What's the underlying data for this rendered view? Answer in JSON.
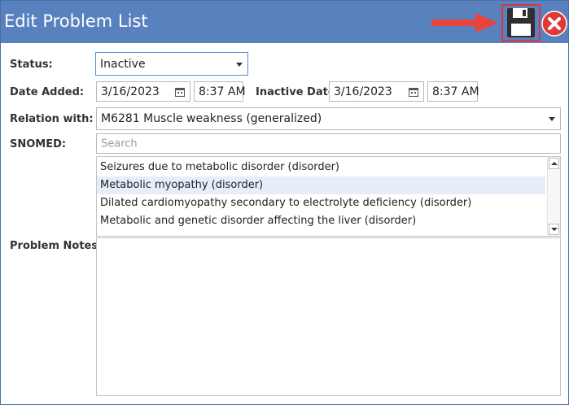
{
  "window": {
    "title": "Edit Problem List"
  },
  "toolbar": {
    "save_icon": "save-icon",
    "close_icon": "close-icon",
    "annotation_color": "#e8453c"
  },
  "form": {
    "status_label": "Status:",
    "status_value": "Inactive",
    "date_added_label": "Date Added:",
    "date_added_value": "3/16/2023",
    "date_added_time": "8:37 AM",
    "inactive_date_label": "Inactive Date:",
    "inactive_date_value": "3/16/2023",
    "inactive_date_time": "8:37 AM",
    "relation_label": "Relation with:",
    "relation_value": "M6281 Muscle weakness (generalized)",
    "snomed_label": "SNOMED:",
    "snomed_placeholder": "Search",
    "snomed_results": [
      "Seizures due to metabolic disorder (disorder)",
      "Metabolic myopathy (disorder)",
      "Dilated cardiomyopathy secondary to electrolyte deficiency (disorder)",
      "Metabolic and genetic disorder affecting the liver (disorder)"
    ],
    "snomed_selected": "Metabolic myopathy (disorder)",
    "notes_label": "Problem Notes:",
    "notes_value": ""
  },
  "colors": {
    "titlebar": "#5881bd",
    "selected_row": "#e5eef9"
  }
}
